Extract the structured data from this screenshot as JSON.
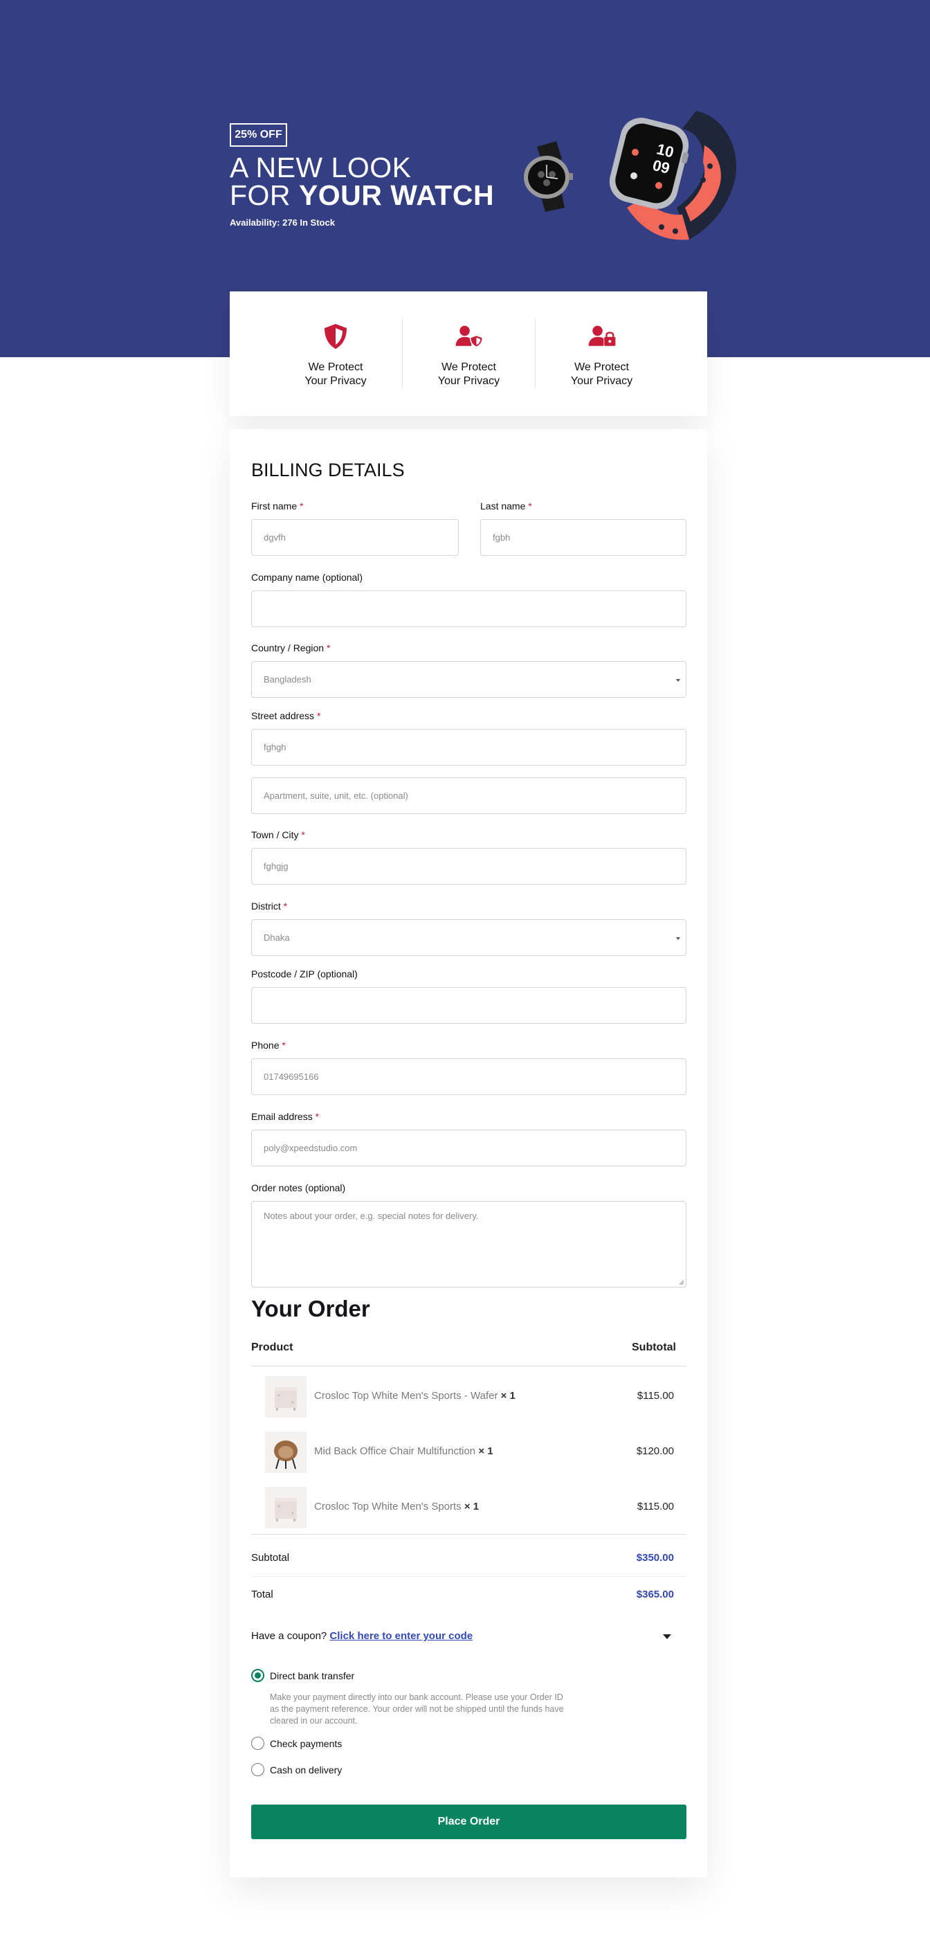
{
  "hero": {
    "badge": "25% OFF",
    "headline_line1": "A NEW LOOK",
    "headline_line2_light": "FOR ",
    "headline_line2_bold": "YOUR WATCH",
    "availability": "Availability: 276 In Stock",
    "background_color": "#343e82"
  },
  "features": [
    {
      "icon": "shield-icon",
      "line1": "We Protect",
      "line2": "Your Privacy"
    },
    {
      "icon": "user-shield-icon",
      "line1": "We Protect",
      "line2": "Your Privacy"
    },
    {
      "icon": "user-lock-icon",
      "line1": "We Protect",
      "line2": "Your Privacy"
    }
  ],
  "billing": {
    "title": "BILLING DETAILS",
    "required_mark": "*",
    "first_name": {
      "label": "First name",
      "value": "dgvfh"
    },
    "last_name": {
      "label": "Last name",
      "value": "fgbh"
    },
    "company": {
      "label": "Company name (optional)",
      "value": ""
    },
    "country": {
      "label": "Country / Region",
      "value": "Bangladesh"
    },
    "street": {
      "label": "Street address",
      "value": "fghgh",
      "placeholder2": "Apartment, suite, unit, etc. (optional)"
    },
    "town": {
      "label": "Town / City",
      "value": "fghgjg"
    },
    "district": {
      "label": "District",
      "value": "Dhaka"
    },
    "postcode": {
      "label": "Postcode / ZIP (optional)",
      "value": ""
    },
    "phone": {
      "label": "Phone",
      "value": "01749695166"
    },
    "email": {
      "label": "Email address",
      "value": "poly@xpeedstudio.com"
    },
    "notes": {
      "label": "Order notes (optional)",
      "placeholder": "Notes about your order, e.g. special notes for delivery."
    }
  },
  "order": {
    "title": "Your Order",
    "col_product": "Product",
    "col_subtotal": "Subtotal",
    "items": [
      {
        "name": "Crosloc Top White Men's Sports - Wafer",
        "qty": "× 1",
        "price": "$115.00",
        "thumb": "cabinet-thumbnail"
      },
      {
        "name": "Mid Back Office Chair Multifunction",
        "qty": "× 1",
        "price": "$120.00",
        "thumb": "chair-thumbnail"
      },
      {
        "name": "Crosloc Top White Men's Sports",
        "qty": "× 1",
        "price": "$115.00",
        "thumb": "cabinet-thumbnail"
      }
    ],
    "subtotal_label": "Subtotal",
    "subtotal_value": "$350.00",
    "total_label": "Total",
    "total_value": "$365.00",
    "accent_color": "#3349b2"
  },
  "coupon": {
    "prompt": "Have a coupon?",
    "link": "Click here to enter your code"
  },
  "payment": {
    "options": [
      {
        "label": "Direct bank transfer",
        "checked": true
      },
      {
        "label": "Check payments",
        "checked": false
      },
      {
        "label": "Cash on delivery",
        "checked": false
      }
    ],
    "bank_description": "Make your payment directly into our bank account. Please use your Order ID as the payment reference. Your order will not be shipped until the funds have cleared in our account.",
    "button": "Place Order",
    "button_color": "#0a8460"
  }
}
